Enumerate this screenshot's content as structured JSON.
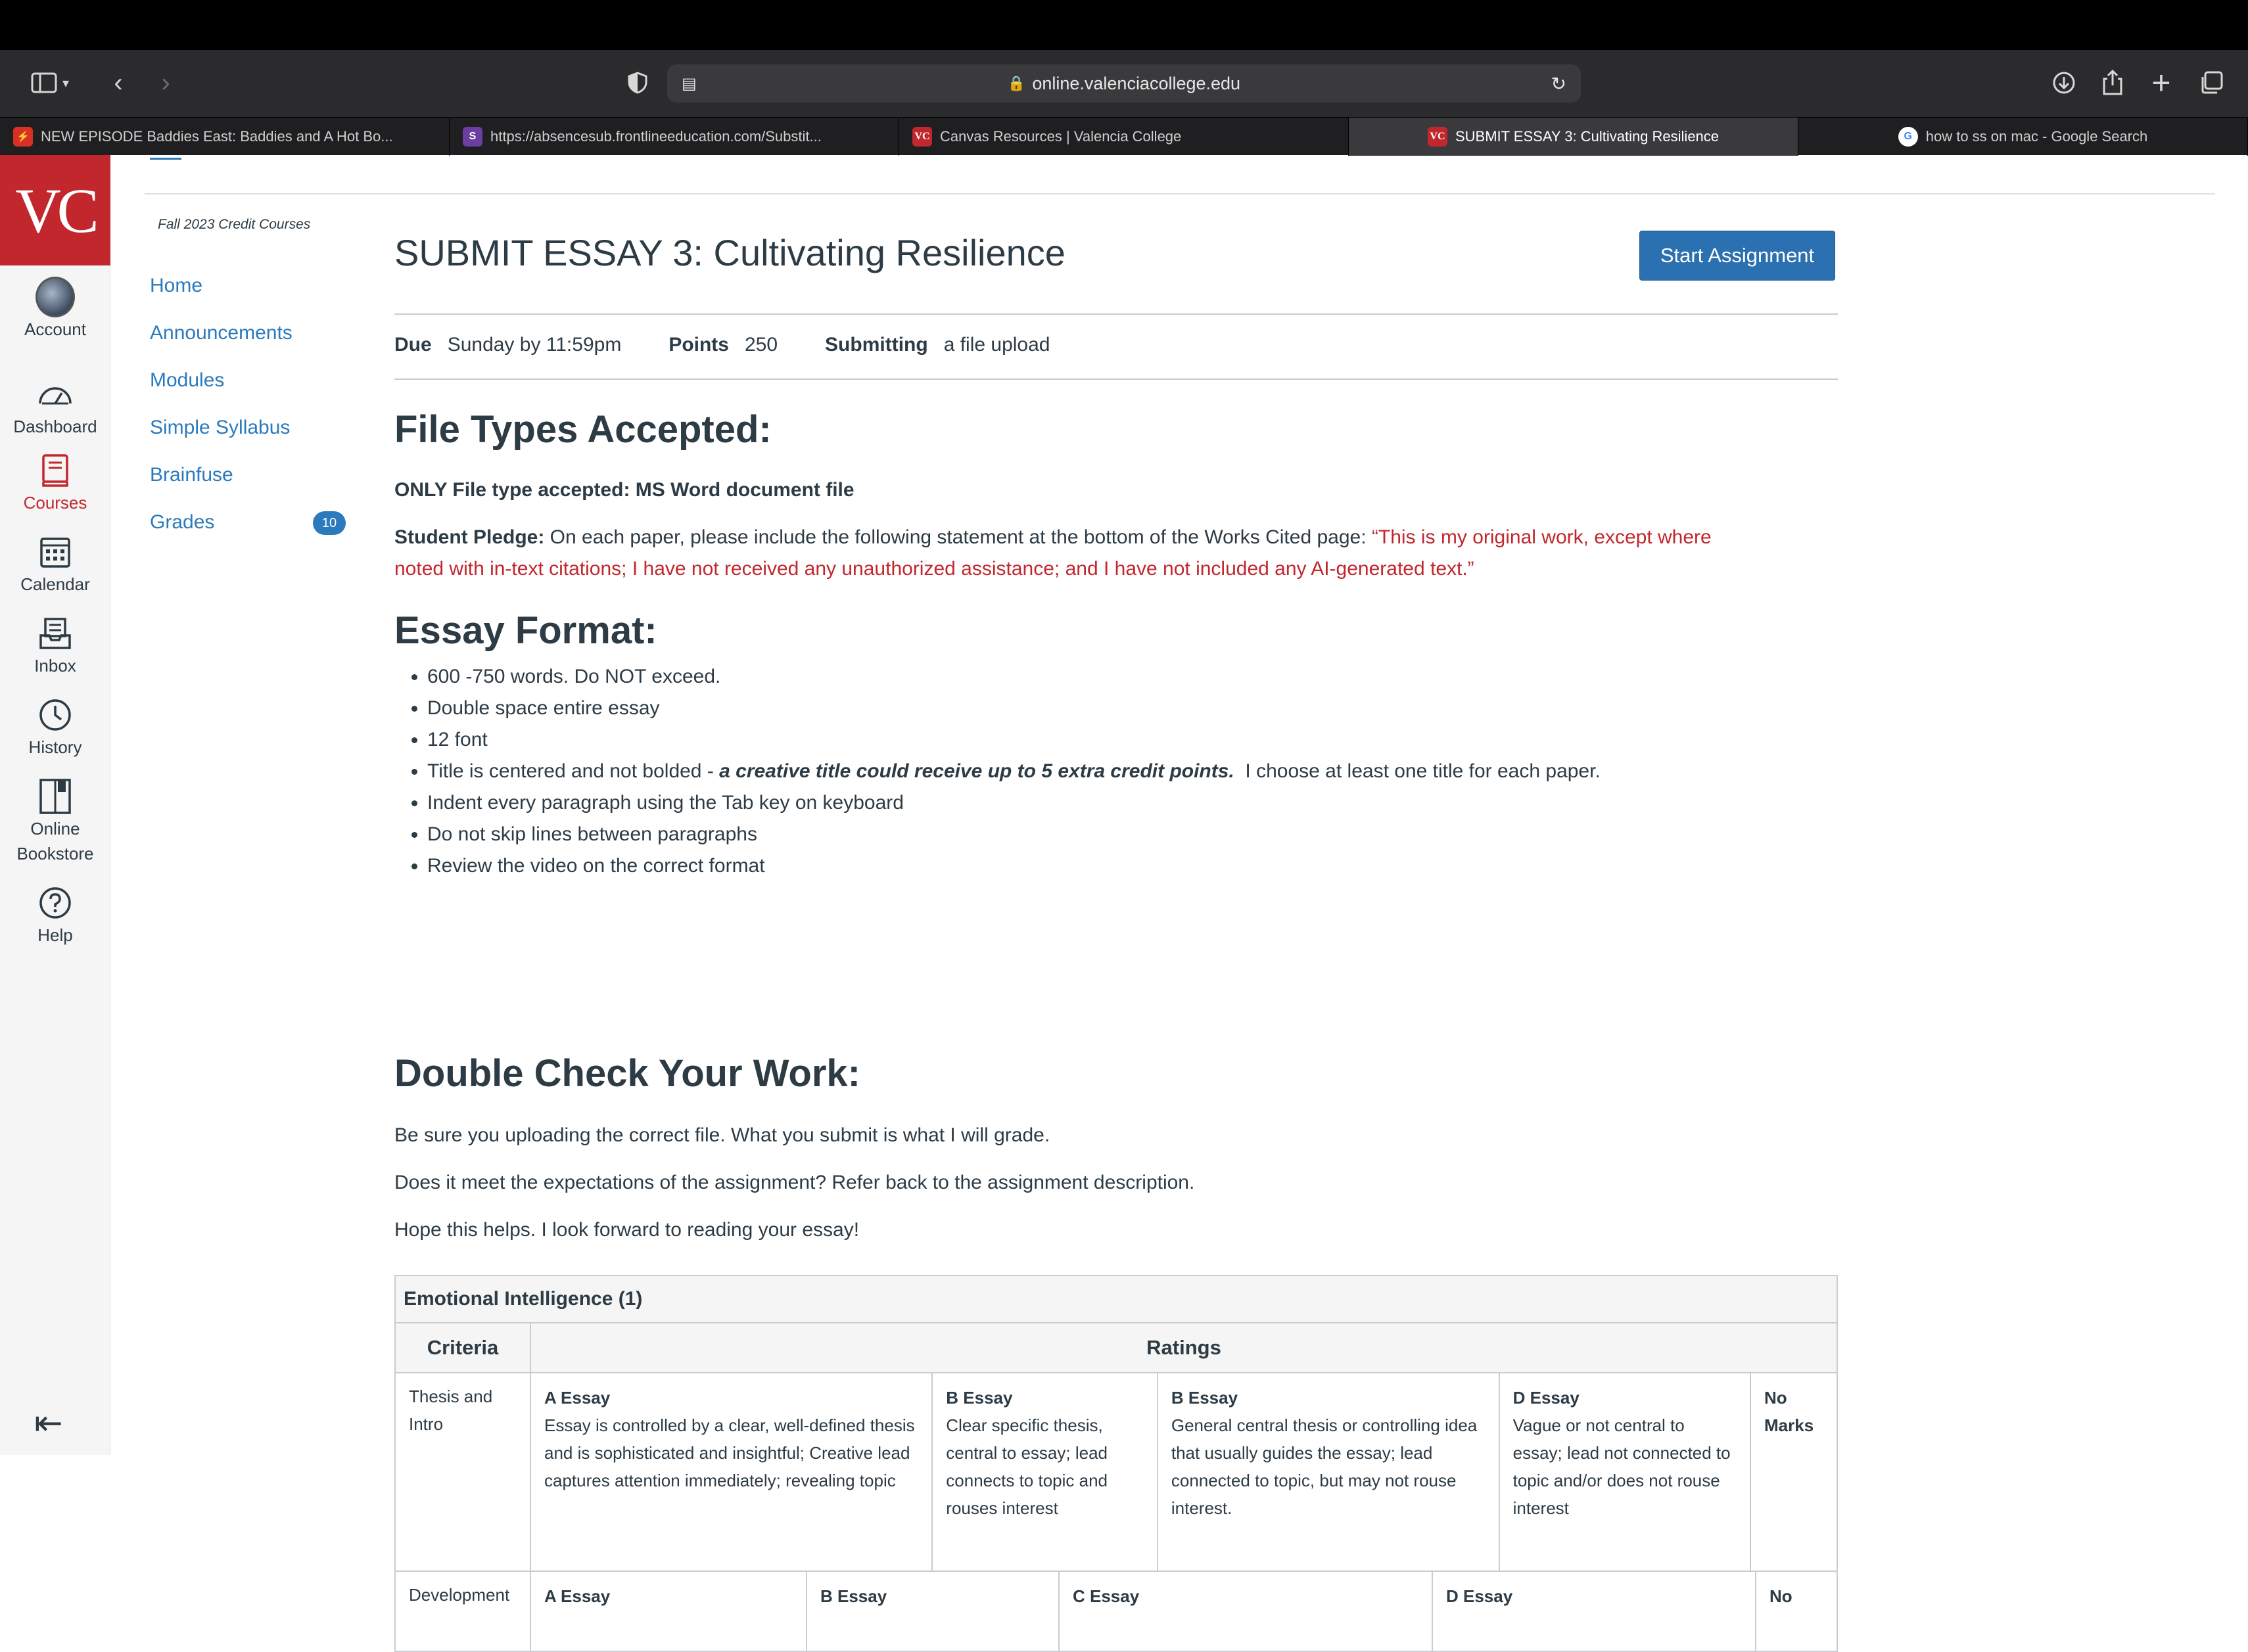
{
  "browser": {
    "url": "online.valenciacollege.edu",
    "tabs": [
      {
        "label": "NEW EPISODE Baddies East: Baddies and A Hot Bo...",
        "fav": "⚡",
        "fav_bg": "#d93025"
      },
      {
        "label": "https://absencesub.frontlineeducation.com/Substit...",
        "fav": "S",
        "fav_bg": "#6b3fa0"
      },
      {
        "label": "Canvas Resources | Valencia College",
        "fav": "VC",
        "fav_bg": "#c1272d"
      },
      {
        "label": "SUBMIT ESSAY 3: Cultivating Resilience",
        "fav": "VC",
        "fav_bg": "#c1272d",
        "active": true
      },
      {
        "label": "how to ss on mac - Google Search",
        "fav": "G",
        "fav_bg": "#ffffff"
      }
    ]
  },
  "logo": "VC",
  "global_nav": {
    "account": "Account",
    "dashboard": "Dashboard",
    "courses": "Courses",
    "calendar": "Calendar",
    "inbox": "Inbox",
    "history": "History",
    "bookstore": "Online Bookstore",
    "help": "Help"
  },
  "course_nav": {
    "term": "Fall 2023 Credit Courses",
    "home": "Home",
    "announcements": "Announcements",
    "modules": "Modules",
    "syllabus": "Simple Syllabus",
    "brainfuse": "Brainfuse",
    "grades": "Grades",
    "grades_badge": "10"
  },
  "assignment": {
    "title": "SUBMIT ESSAY 3: Cultivating Resilience",
    "start_button": "Start Assignment",
    "due_label": "Due",
    "due_value": "Sunday by 11:59pm",
    "points_label": "Points",
    "points_value": "250",
    "submitting_label": "Submitting",
    "submitting_value": "a file upload"
  },
  "content": {
    "h_file_types": "File Types Accepted:",
    "only_file": "ONLY File type accepted: MS Word document file",
    "pledge_label": "Student Pledge:",
    "pledge_text": " On each paper, please include the following statement at the bottom of the Works Cited page: ",
    "pledge_quote_1": "“This is my original work, except where",
    "pledge_quote_2": "noted with in-text citations; I have not received any unauthorized assistance; and I have not included any AI-generated text.”",
    "h_essay_format": "Essay Format:",
    "fmt_1": "600 -750 words. Do NOT exceed.",
    "fmt_2": "Double space entire essay",
    "fmt_3": "12 font",
    "fmt_4a": "Title is centered and not bolded - ",
    "fmt_4b": "a creative title could receive up to 5 extra credit points.",
    "fmt_4c": "  I choose at least one title for each paper.",
    "fmt_5": "Indent every paragraph using the Tab key on keyboard",
    "fmt_6": "Do not skip lines between paragraphs",
    "fmt_7": "Review the video on the correct format",
    "h_double_check": "Double Check Your Work:",
    "dc_1": "Be sure you uploading the correct file. What you submit is what I will grade.",
    "dc_2": "Does it meet the expectations of the assignment? Refer back to the assignment description.",
    "dc_3": "Hope this helps. I look forward to reading your essay!"
  },
  "rubric": {
    "title": "Emotional Intelligence (1)",
    "criteria_header": "Criteria",
    "ratings_header": "Ratings",
    "row1": {
      "criterion": "Thesis and Intro",
      "r1_title": "A Essay",
      "r1_desc": "Essay is controlled by a clear, well-defined thesis and is sophisticated and insightful; Creative lead captures attention immediately; revealing topic",
      "r2_title": "B Essay",
      "r2_desc": "Clear specific thesis, central to essay; lead connects to topic and rouses interest",
      "r3_title": "B Essay",
      "r3_desc": "General central thesis or controlling idea that usually guides the essay; lead connected to topic, but may not rouse interest.",
      "r4_title": "D Essay",
      "r4_desc": "Vague or not central to essay; lead not connected to topic and/or does not rouse interest",
      "r5_title": "No Marks"
    },
    "row2": {
      "criterion": "Development",
      "r1_title": "A Essay",
      "r2_title": "B Essay",
      "r3_title": "C Essay",
      "r4_title": "D Essay",
      "r5_title": "No"
    }
  }
}
